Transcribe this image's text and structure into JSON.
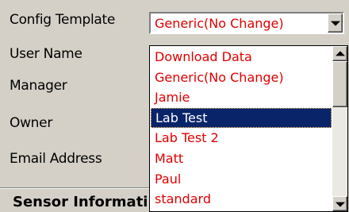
{
  "form": {
    "labels": {
      "config_template": "Config Template",
      "user_name": "User Name",
      "manager": "Manager",
      "owner": "Owner",
      "email_address": "Email Address"
    },
    "config_template_value": "Generic(No Change)",
    "section_header": "Sensor Informati"
  },
  "dropdown": {
    "options": [
      "Download Data",
      "Generic(No Change)",
      "Jamie",
      "Lab Test",
      "Lab Test 2",
      "Matt",
      "Paul",
      "standard"
    ],
    "selected": "Lab Test"
  },
  "icons": {
    "combo_arrow": "chevron-down-icon",
    "scroll_up": "scroll-up-arrow-icon",
    "scroll_down": "scroll-down-arrow-icon"
  },
  "colors": {
    "dialog_bg": "#d4d0c8",
    "option_text": "#e00000",
    "selection_bg": "#0a246a",
    "selection_text": "#ffffff"
  }
}
